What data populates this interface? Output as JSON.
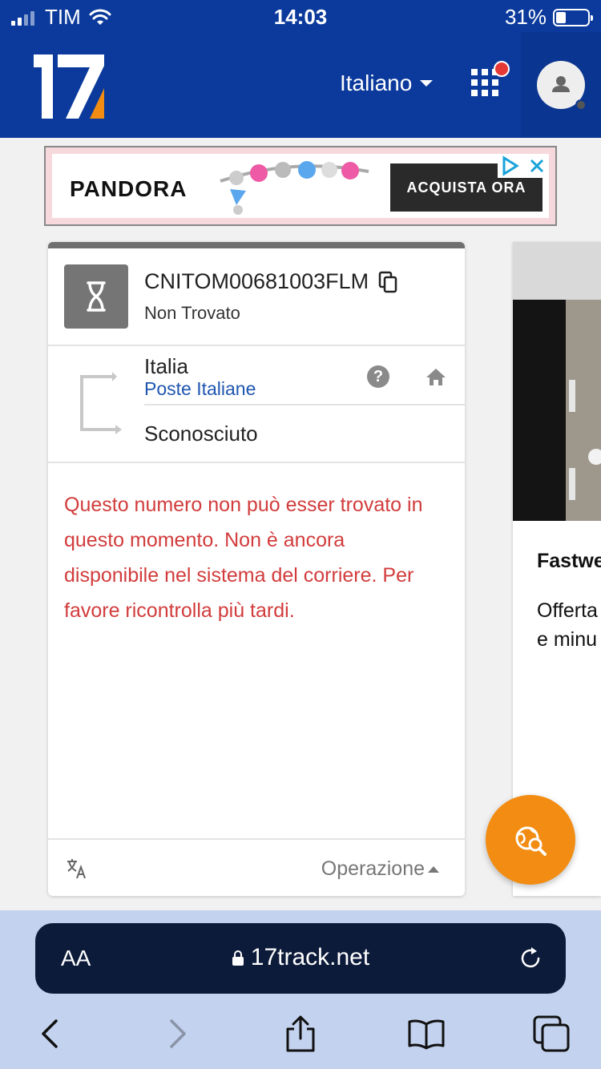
{
  "status_bar": {
    "carrier": "TIM",
    "time": "14:03",
    "battery": "31%"
  },
  "header": {
    "logo": "17",
    "language": "Italiano",
    "icons": [
      "apps-grid-icon",
      "notification-dot",
      "avatar-icon"
    ]
  },
  "ad": {
    "brand": "PANDORA",
    "cta": "ACQUISTA ORA",
    "icons": [
      "adchoices-icon",
      "close-icon"
    ]
  },
  "tracking_card": {
    "tracking_number": "CNITOM00681003FLM",
    "status": "Non Trovato",
    "country": "Italia",
    "carrier": "Poste Italiane",
    "destination_status": "Sconosciuto",
    "message": "Questo numero non può esser trovato in questo momento. Non è ancora disponibile nel sistema del corriere. Per favore ricontrolla più tardi.",
    "footer_action": "Operazione",
    "colors": {
      "message": "#d23c3c",
      "carrier_link": "#1e56b0",
      "top_border": "#6f6f6f"
    }
  },
  "side_card": {
    "title": "Fastwe",
    "text_line1": "Offerta",
    "text_line2": "e minu"
  },
  "browser": {
    "aa": "AA",
    "url": "17track.net",
    "icons": [
      "back-icon",
      "forward-icon",
      "share-icon",
      "bookmarks-icon",
      "tabs-icon"
    ]
  },
  "colors": {
    "header_bg": "#0b3a9c",
    "fab": "#f28c12",
    "safari_bar": "#c3d2ee"
  }
}
